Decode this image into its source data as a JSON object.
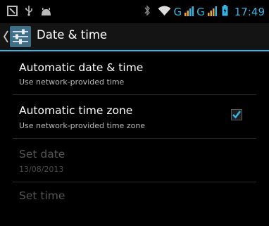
{
  "status_bar": {
    "icons_left": [
      "notification-icon",
      "usb-icon",
      "android-debug-icon"
    ],
    "icons_right": [
      "bluetooth-icon",
      "wifi-icon",
      "signal-icon",
      "signal-icon",
      "battery-icon"
    ],
    "network_type_1": "G",
    "network_type_2": "G",
    "time": "17:49",
    "accent_color": "#33b5e5"
  },
  "action_bar": {
    "title": "Date & time",
    "back_icon": "chevron-left-icon",
    "app_icon": "settings-sliders-icon"
  },
  "settings": [
    {
      "title": "Automatic date & time",
      "summary": "Use network-provided time",
      "enabled": true,
      "has_checkbox": false
    },
    {
      "title": "Automatic time zone",
      "summary": "Use network-provided time zone",
      "enabled": true,
      "has_checkbox": true,
      "checked": true
    },
    {
      "title": "Set date",
      "summary": "13/08/2013",
      "enabled": false,
      "has_checkbox": false
    },
    {
      "title": "Set time",
      "summary": "",
      "enabled": false,
      "has_checkbox": false
    }
  ]
}
